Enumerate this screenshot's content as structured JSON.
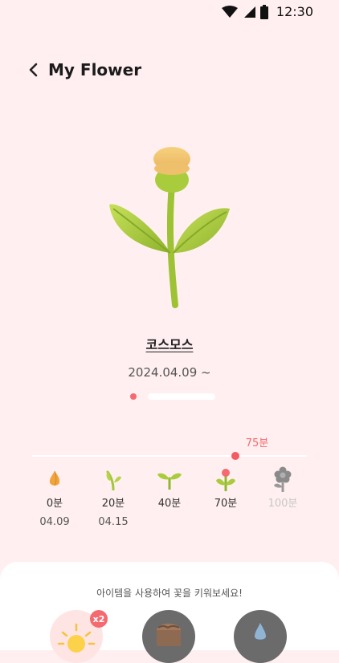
{
  "status_bar": {
    "time": "12:30"
  },
  "header": {
    "title": "My Flower"
  },
  "flower": {
    "name": "코스모스",
    "date_range": "2024.04.09 ~"
  },
  "progress": {
    "current_label": "75분",
    "current_minutes": 75,
    "max_minutes": 100
  },
  "stages": [
    {
      "icon": "seed-icon",
      "minutes": "0분",
      "date": "04.09",
      "locked": false
    },
    {
      "icon": "sprout-icon",
      "minutes": "20분",
      "date": "04.15",
      "locked": false
    },
    {
      "icon": "seedling-icon",
      "minutes": "40분",
      "date": "",
      "locked": false
    },
    {
      "icon": "bud-icon",
      "minutes": "70분",
      "date": "",
      "locked": false
    },
    {
      "icon": "flower-icon",
      "minutes": "100분",
      "date": "",
      "locked": true
    }
  ],
  "items_panel": {
    "caption": "아이템을 사용하여 꽃을 키워보세요!",
    "items": [
      {
        "icon": "sun-icon",
        "badge": "x2"
      },
      {
        "icon": "soil-icon"
      },
      {
        "icon": "water-drop-icon"
      }
    ]
  },
  "colors": {
    "background": "#ffeff0",
    "accent": "#f46a6e",
    "leaf": "#a9cc3c"
  }
}
